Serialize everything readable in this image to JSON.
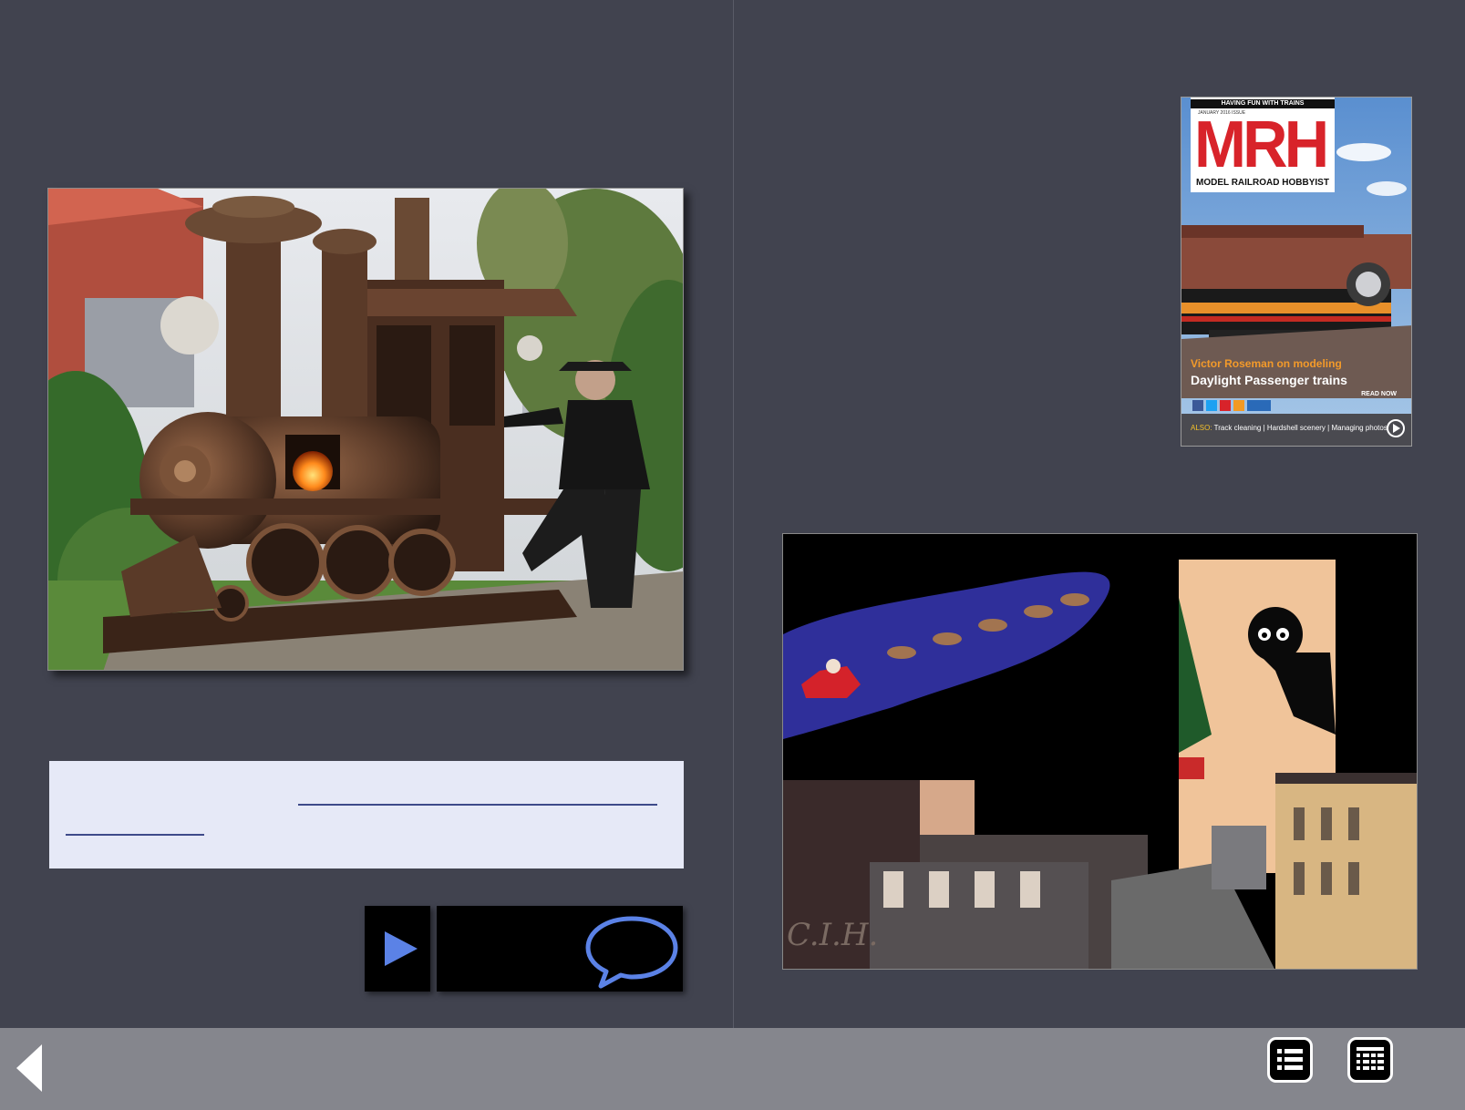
{
  "cover": {
    "tagline": "HAVING FUN WITH TRAINS",
    "issue": "JANUARY 2016 ISSUE",
    "logo": "MRH",
    "masthead": "MODEL RAILROAD HOBBYIST",
    "headline_1": "Victor Roseman on modeling",
    "headline_2": "Daylight Passenger trains",
    "cta": "READ NOW",
    "also_label": "ALSO:",
    "also_text": "Track cleaning | Hardshell scenery | Managing photos"
  },
  "cartoon": {
    "signature": "C.I.H."
  },
  "colors": {
    "background": "#41434f",
    "caption_bg": "#e6e9f7",
    "link_underline": "#3e4a8a",
    "play_accent": "#5b82e6",
    "navbar": "#85868d",
    "mrh_red": "#d8232a"
  },
  "icons": {
    "play": "play-icon",
    "comment": "speech-bubble-icon",
    "back": "back-arrow-icon",
    "toc": "list-icon",
    "index": "grid-list-icon"
  }
}
